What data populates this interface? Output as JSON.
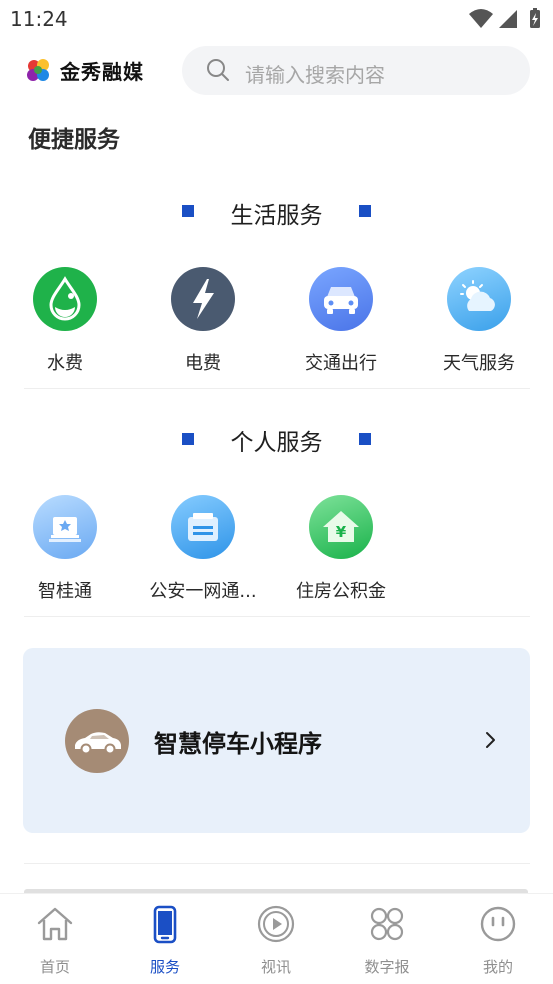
{
  "status_bar": {
    "time": "11:24"
  },
  "header": {
    "logo_text": "金秀融媒",
    "search_placeholder": "请输入搜索内容"
  },
  "page_title": "便捷服务",
  "sections": [
    {
      "title": "生活服务",
      "items": [
        {
          "label": "水费",
          "icon": "water-drop-icon",
          "color": "#1fb24a"
        },
        {
          "label": "电费",
          "icon": "lightning-icon",
          "color": "#4a5a70"
        },
        {
          "label": "交通出行",
          "icon": "car-icon",
          "color": "#5d8ef5"
        },
        {
          "label": "天气服务",
          "icon": "weather-icon",
          "color": "#56b4f2"
        }
      ]
    },
    {
      "title": "个人服务",
      "items": [
        {
          "label": "智桂通",
          "icon": "building-icon",
          "color": "#7fb8f5"
        },
        {
          "label": "公安一网通...",
          "icon": "id-card-icon",
          "color": "#3fa3ef"
        },
        {
          "label": "住房公积金",
          "icon": "house-yuan-icon",
          "color": "#2ec35b"
        }
      ]
    }
  ],
  "banner": {
    "title": "智慧停车小程序",
    "icon": "car-icon"
  },
  "tabbar": {
    "active_index": 1,
    "accent": "#1b4fc5",
    "tabs": [
      {
        "label": "首页",
        "icon": "home-icon"
      },
      {
        "label": "服务",
        "icon": "phone-icon"
      },
      {
        "label": "视讯",
        "icon": "play-icon"
      },
      {
        "label": "数字报",
        "icon": "grid-icon"
      },
      {
        "label": "我的",
        "icon": "smiley-icon"
      }
    ]
  }
}
